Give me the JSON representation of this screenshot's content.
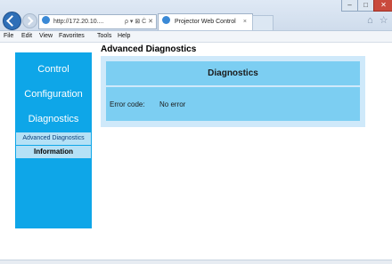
{
  "browser": {
    "address_text": "http://172.20.10....",
    "address_tools": "ρ ▾ ⊠ Ċ ✕",
    "tab_title": "Projector Web Control",
    "tab_close": "×",
    "right_icons": "⌂ ☆",
    "window_controls": {
      "minimize": "–",
      "maximize": "□",
      "close": "✕"
    },
    "menu": [
      "File",
      "Edit",
      "View",
      "Favorites",
      "Tools",
      "Help"
    ]
  },
  "page": {
    "title": "Advanced Diagnostics"
  },
  "sidebar": {
    "items": [
      "Control",
      "Configuration",
      "Diagnostics"
    ],
    "subitems": [
      "Advanced Diagnostics",
      "Information"
    ]
  },
  "panel": {
    "title": "Diagnostics",
    "error_label": "Error code:",
    "error_value": "No error"
  },
  "colors": {
    "sidebar_blue": "#0ea6e8",
    "panel_blue": "#7ccef2",
    "panel_bg": "#cfe9fa"
  },
  "icons": [
    "back-icon",
    "forward-icon",
    "page-icon",
    "tab-icon",
    "home-icon",
    "favorites-icon",
    "minimize-icon",
    "maximize-icon",
    "close-icon"
  ]
}
